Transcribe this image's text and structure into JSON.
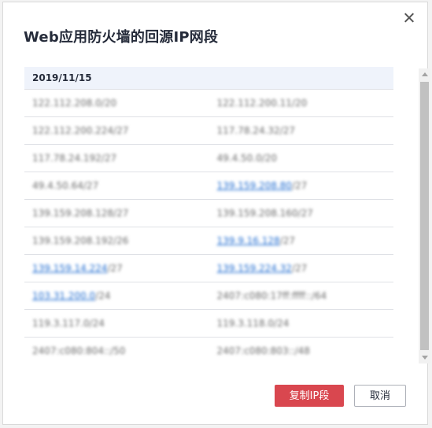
{
  "dialog": {
    "title": "Web应用防火墙的回源IP网段",
    "table": {
      "header_date": "2019/11/15",
      "rows": [
        [
          {
            "text": "122.112.208.0/20"
          },
          {
            "text": "122.112.200.11/20"
          }
        ],
        [
          {
            "text": "122.112.200.224/27"
          },
          {
            "text": "117.78.24.32/27"
          }
        ],
        [
          {
            "text": "117.78.24.192/27"
          },
          {
            "text": "49.4.50.0/20"
          }
        ],
        [
          {
            "text": "49.4.50.64/27"
          },
          {
            "text": "139.159.208.80",
            "link": true,
            "suffix": "/27"
          }
        ],
        [
          {
            "text": "139.159.208.128/27"
          },
          {
            "text": "139.159.208.160/27"
          }
        ],
        [
          {
            "text": "139.159.208.192/26"
          },
          {
            "text": "139.9.16.128",
            "link": true,
            "suffix": "/27"
          }
        ],
        [
          {
            "text": "139.159.14.224",
            "link": true,
            "suffix": "/27"
          },
          {
            "text": "139.159.224.32",
            "link": true,
            "suffix": "/27"
          }
        ],
        [
          {
            "text": "103.31.200.0",
            "link": true,
            "suffix": "/24"
          },
          {
            "text": "2407:c080:17ff:ffff::/64"
          }
        ],
        [
          {
            "text": "119.3.117.0/24"
          },
          {
            "text": "119.3.118.0/24"
          }
        ],
        [
          {
            "text": "2407:c080:804::/50"
          },
          {
            "text": "2407:c080:803::/48"
          }
        ]
      ]
    },
    "buttons": {
      "copy_label": "复制IP段",
      "cancel_label": "取消"
    },
    "colors": {
      "primary": "#d9474f",
      "link": "#1e6bd0",
      "header_bg": "#eff3fb"
    }
  }
}
